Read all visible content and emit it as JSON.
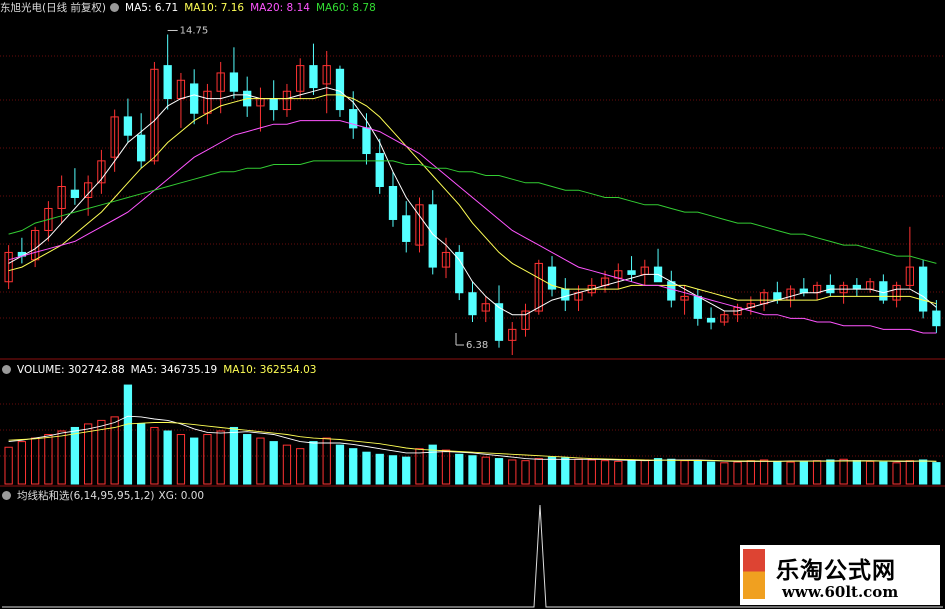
{
  "header": {
    "stock_title": "东旭光电(日线 前复权)",
    "ma5": "MA5: 6.71",
    "ma10": "MA10: 7.16",
    "ma20": "MA20: 8.14",
    "ma60": "MA60: 8.78"
  },
  "volume_header": {
    "title": "VOLUME: 302742.88",
    "ma5": "MA5: 346735.19",
    "ma10": "MA10: 362554.03"
  },
  "indicator_header": {
    "title": "均线粘和选(6,14,95,95,1,2)",
    "xg": "XG: 0.00"
  },
  "watermark": {
    "name": "乐淘公式网",
    "url": "www.60lt.com"
  },
  "colors": {
    "up": "#ff3333",
    "down": "#54ffff",
    "ma5": "#ffffff",
    "ma10": "#ffff55",
    "ma20": "#ff55ff",
    "ma60": "#33cc33",
    "grid": "#8b1010",
    "bg": "#000000"
  },
  "chart_data": {
    "type": "candlestick",
    "price": {
      "ylim": [
        6.0,
        15.2
      ],
      "max_label": "14.75",
      "min_label": "6.38",
      "max_point": {
        "x": 48,
        "value": 14.75
      },
      "min_point": {
        "x": 456,
        "value": 6.38
      },
      "ohlc": [
        [
          8.0,
          9.0,
          7.8,
          8.8
        ],
        [
          8.8,
          9.2,
          8.5,
          8.7
        ],
        [
          8.6,
          9.5,
          8.4,
          9.4
        ],
        [
          9.4,
          10.2,
          9.1,
          10.0
        ],
        [
          10.0,
          10.9,
          9.6,
          10.6
        ],
        [
          10.5,
          11.1,
          10.1,
          10.3
        ],
        [
          10.3,
          10.9,
          9.8,
          10.7
        ],
        [
          10.7,
          11.6,
          10.4,
          11.3
        ],
        [
          11.4,
          12.7,
          11.0,
          12.5
        ],
        [
          12.5,
          13.0,
          11.8,
          12.0
        ],
        [
          12.0,
          12.6,
          11.1,
          11.3
        ],
        [
          11.3,
          14.0,
          11.2,
          13.8
        ],
        [
          13.9,
          14.75,
          12.7,
          13.0
        ],
        [
          13.0,
          13.7,
          12.2,
          13.5
        ],
        [
          13.4,
          13.8,
          12.3,
          12.6
        ],
        [
          12.6,
          13.4,
          12.3,
          13.2
        ],
        [
          13.2,
          14.0,
          12.6,
          13.7
        ],
        [
          13.7,
          14.4,
          13.0,
          13.2
        ],
        [
          13.2,
          13.6,
          12.5,
          12.8
        ],
        [
          12.8,
          13.3,
          12.1,
          13.0
        ],
        [
          13.0,
          13.5,
          12.4,
          12.7
        ],
        [
          12.7,
          13.4,
          12.5,
          13.2
        ],
        [
          13.2,
          14.1,
          13.0,
          13.9
        ],
        [
          13.9,
          14.5,
          13.1,
          13.3
        ],
        [
          13.4,
          14.3,
          12.6,
          13.9
        ],
        [
          13.8,
          13.9,
          12.5,
          12.7
        ],
        [
          12.7,
          13.2,
          11.9,
          12.2
        ],
        [
          12.2,
          12.6,
          11.2,
          11.5
        ],
        [
          11.5,
          11.9,
          10.4,
          10.6
        ],
        [
          10.6,
          11.0,
          9.5,
          9.7
        ],
        [
          9.8,
          10.2,
          8.8,
          9.1
        ],
        [
          9.0,
          10.3,
          8.8,
          10.1
        ],
        [
          10.1,
          10.5,
          8.2,
          8.4
        ],
        [
          8.4,
          9.2,
          8.1,
          8.8
        ],
        [
          8.8,
          9.0,
          7.5,
          7.7
        ],
        [
          7.7,
          8.0,
          6.9,
          7.1
        ],
        [
          7.2,
          7.6,
          6.9,
          7.4
        ],
        [
          7.4,
          7.9,
          6.2,
          6.4
        ],
        [
          6.4,
          6.9,
          6.0,
          6.7
        ],
        [
          6.7,
          7.4,
          6.5,
          7.2
        ],
        [
          7.2,
          8.6,
          7.1,
          8.5
        ],
        [
          8.4,
          8.7,
          7.6,
          7.8
        ],
        [
          7.8,
          8.1,
          7.2,
          7.5
        ],
        [
          7.5,
          7.9,
          7.2,
          7.7
        ],
        [
          7.7,
          8.1,
          7.6,
          7.9
        ],
        [
          7.9,
          8.3,
          7.7,
          8.1
        ],
        [
          8.1,
          8.5,
          7.8,
          8.3
        ],
        [
          8.3,
          8.7,
          8.0,
          8.2
        ],
        [
          8.2,
          8.6,
          7.9,
          8.4
        ],
        [
          8.4,
          8.9,
          8.1,
          8.0
        ],
        [
          8.0,
          8.3,
          7.3,
          7.5
        ],
        [
          7.5,
          7.9,
          7.1,
          7.6
        ],
        [
          7.6,
          7.8,
          6.8,
          7.0
        ],
        [
          7.0,
          7.3,
          6.7,
          6.9
        ],
        [
          6.9,
          7.2,
          6.8,
          7.1
        ],
        [
          7.1,
          7.4,
          6.9,
          7.3
        ],
        [
          7.3,
          7.6,
          7.1,
          7.4
        ],
        [
          7.4,
          7.8,
          7.2,
          7.7
        ],
        [
          7.7,
          8.0,
          7.4,
          7.5
        ],
        [
          7.5,
          7.9,
          7.3,
          7.8
        ],
        [
          7.8,
          8.1,
          7.6,
          7.7
        ],
        [
          7.7,
          8.0,
          7.5,
          7.9
        ],
        [
          7.9,
          8.2,
          7.6,
          7.7
        ],
        [
          7.7,
          8.0,
          7.4,
          7.9
        ],
        [
          7.9,
          8.1,
          7.6,
          7.8
        ],
        [
          7.8,
          8.1,
          7.7,
          8.0
        ],
        [
          8.0,
          8.2,
          7.4,
          7.5
        ],
        [
          7.5,
          8.0,
          7.3,
          7.9
        ],
        [
          7.9,
          9.5,
          7.8,
          8.4
        ],
        [
          8.4,
          8.6,
          7.0,
          7.2
        ],
        [
          7.2,
          7.5,
          6.6,
          6.8
        ]
      ],
      "series": [
        {
          "key": "ma5",
          "values": [
            8.5,
            8.7,
            8.9,
            9.2,
            9.6,
            10.0,
            10.4,
            10.8,
            11.3,
            11.8,
            12.1,
            12.4,
            12.8,
            13.0,
            13.1,
            13.0,
            13.0,
            13.1,
            13.1,
            13.0,
            13.0,
            13.0,
            13.1,
            13.2,
            13.3,
            13.2,
            12.9,
            12.4,
            11.8,
            11.0,
            10.3,
            9.8,
            9.3,
            9.0,
            8.6,
            8.0,
            7.6,
            7.3,
            7.1,
            7.1,
            7.3,
            7.5,
            7.6,
            7.7,
            7.8,
            7.9,
            8.0,
            8.1,
            8.2,
            8.2,
            8.0,
            7.8,
            7.6,
            7.4,
            7.2,
            7.2,
            7.3,
            7.4,
            7.5,
            7.6,
            7.7,
            7.7,
            7.8,
            7.8,
            7.8,
            7.8,
            7.7,
            7.8,
            7.8,
            7.6,
            7.3
          ]
        },
        {
          "key": "ma10",
          "values": [
            8.3,
            8.4,
            8.6,
            8.8,
            9.0,
            9.3,
            9.6,
            9.9,
            10.3,
            10.7,
            11.1,
            11.4,
            11.8,
            12.1,
            12.4,
            12.6,
            12.8,
            12.9,
            13.0,
            13.0,
            13.0,
            13.0,
            13.0,
            13.0,
            13.1,
            13.1,
            13.0,
            12.8,
            12.5,
            12.1,
            11.7,
            11.3,
            10.9,
            10.5,
            10.1,
            9.6,
            9.2,
            8.8,
            8.5,
            8.3,
            8.1,
            7.9,
            7.8,
            7.8,
            7.8,
            7.8,
            7.8,
            7.9,
            7.9,
            7.9,
            7.9,
            7.9,
            7.8,
            7.7,
            7.6,
            7.5,
            7.5,
            7.5,
            7.5,
            7.5,
            7.5,
            7.5,
            7.6,
            7.6,
            7.6,
            7.6,
            7.6,
            7.6,
            7.6,
            7.5,
            7.4
          ]
        },
        {
          "key": "ma20",
          "values": [
            8.6,
            8.7,
            8.8,
            8.9,
            9.0,
            9.1,
            9.3,
            9.5,
            9.7,
            9.9,
            10.2,
            10.5,
            10.8,
            11.1,
            11.4,
            11.6,
            11.8,
            12.0,
            12.1,
            12.2,
            12.3,
            12.3,
            12.4,
            12.4,
            12.4,
            12.4,
            12.3,
            12.2,
            12.1,
            11.9,
            11.7,
            11.5,
            11.2,
            10.9,
            10.6,
            10.3,
            10.0,
            9.7,
            9.4,
            9.2,
            9.0,
            8.8,
            8.6,
            8.4,
            8.3,
            8.2,
            8.1,
            8.0,
            7.9,
            7.9,
            7.8,
            7.7,
            7.6,
            7.5,
            7.4,
            7.3,
            7.2,
            7.1,
            7.1,
            7.0,
            7.0,
            6.9,
            6.9,
            6.8,
            6.8,
            6.8,
            6.7,
            6.7,
            6.7,
            6.6,
            6.6
          ]
        },
        {
          "key": "ma60",
          "values": [
            9.3,
            9.4,
            9.6,
            9.7,
            9.8,
            9.9,
            10.0,
            10.1,
            10.2,
            10.3,
            10.4,
            10.5,
            10.6,
            10.7,
            10.8,
            10.9,
            11.0,
            11.0,
            11.1,
            11.1,
            11.2,
            11.2,
            11.2,
            11.3,
            11.3,
            11.3,
            11.3,
            11.3,
            11.3,
            11.3,
            11.2,
            11.2,
            11.1,
            11.1,
            11.0,
            11.0,
            10.9,
            10.9,
            10.8,
            10.7,
            10.7,
            10.6,
            10.5,
            10.5,
            10.4,
            10.3,
            10.3,
            10.2,
            10.1,
            10.1,
            10.0,
            9.9,
            9.9,
            9.8,
            9.7,
            9.6,
            9.6,
            9.5,
            9.4,
            9.3,
            9.3,
            9.2,
            9.1,
            9.0,
            9.0,
            8.9,
            8.8,
            8.7,
            8.7,
            8.6,
            8.5
          ]
        }
      ]
    },
    "volume": {
      "ylim": [
        0,
        1500000
      ],
      "values": [
        520000,
        600000,
        650000,
        700000,
        750000,
        800000,
        850000,
        900000,
        950000,
        1400000,
        850000,
        800000,
        750000,
        700000,
        650000,
        700000,
        750000,
        800000,
        700000,
        650000,
        600000,
        550000,
        500000,
        600000,
        650000,
        550000,
        500000,
        450000,
        420000,
        400000,
        380000,
        500000,
        550000,
        480000,
        420000,
        400000,
        380000,
        360000,
        340000,
        330000,
        360000,
        380000,
        370000,
        350000,
        340000,
        330000,
        320000,
        330000,
        340000,
        360000,
        350000,
        330000,
        320000,
        310000,
        300000,
        310000,
        330000,
        340000,
        320000,
        310000,
        320000,
        330000,
        340000,
        350000,
        330000,
        320000,
        310000,
        300000,
        330000,
        340000,
        302742.88
      ],
      "up": [
        true,
        true,
        true,
        true,
        true,
        false,
        true,
        true,
        true,
        false,
        false,
        true,
        false,
        true,
        false,
        true,
        true,
        false,
        false,
        true,
        false,
        true,
        true,
        false,
        true,
        false,
        false,
        false,
        false,
        false,
        false,
        true,
        false,
        true,
        false,
        false,
        true,
        false,
        true,
        true,
        true,
        false,
        false,
        true,
        true,
        true,
        true,
        false,
        true,
        false,
        false,
        true,
        false,
        false,
        true,
        true,
        true,
        true,
        false,
        true,
        false,
        true,
        false,
        true,
        false,
        true,
        false,
        true,
        true,
        false,
        false
      ],
      "ma5_values": [
        600000,
        620000,
        650000,
        680000,
        720000,
        750000,
        780000,
        820000,
        870000,
        960000,
        950000,
        920000,
        900000,
        850000,
        780000,
        730000,
        720000,
        730000,
        740000,
        720000,
        700000,
        650000,
        600000,
        580000,
        580000,
        580000,
        560000,
        530000,
        500000,
        470000,
        440000,
        440000,
        450000,
        460000,
        450000,
        440000,
        420000,
        400000,
        380000,
        360000,
        350000,
        350000,
        350000,
        350000,
        350000,
        345000,
        340000,
        335000,
        330000,
        335000,
        340000,
        340000,
        340000,
        335000,
        325000,
        320000,
        320000,
        320000,
        320000,
        325000,
        325000,
        325000,
        325000,
        330000,
        330000,
        330000,
        325000,
        320000,
        320000,
        325000,
        320000
      ],
      "ma10_values": [
        620000,
        630000,
        640000,
        660000,
        680000,
        710000,
        740000,
        770000,
        800000,
        850000,
        860000,
        870000,
        870000,
        860000,
        840000,
        820000,
        800000,
        780000,
        760000,
        740000,
        720000,
        700000,
        670000,
        650000,
        640000,
        630000,
        610000,
        590000,
        570000,
        540000,
        510000,
        490000,
        480000,
        470000,
        460000,
        450000,
        440000,
        430000,
        420000,
        410000,
        400000,
        390000,
        380000,
        370000,
        360000,
        355000,
        350000,
        345000,
        340000,
        338000,
        336000,
        334000,
        332000,
        330000,
        328000,
        326000,
        325000,
        324000,
        323000,
        322000,
        322000,
        322000,
        323000,
        324000,
        325000,
        326000,
        326000,
        325000,
        324000,
        324000,
        322000
      ]
    },
    "indicator": {
      "type": "line",
      "ylim": [
        0,
        1
      ],
      "values": [
        0,
        0,
        0,
        0,
        0,
        0,
        0,
        0,
        0,
        0,
        0,
        0,
        0,
        0,
        0,
        0,
        0,
        0,
        0,
        0,
        0,
        0,
        0,
        0,
        0,
        0,
        0,
        0,
        0,
        0,
        0,
        0,
        0,
        0,
        0,
        0,
        0,
        0,
        0,
        0,
        0,
        0,
        0,
        0,
        0,
        0,
        0,
        0,
        0,
        0,
        0,
        0,
        0,
        0,
        0,
        0,
        0,
        0,
        0,
        0,
        0,
        0,
        0,
        0,
        0,
        0,
        0,
        0,
        0,
        0,
        0
      ],
      "spike": {
        "x": 540,
        "value": 1
      }
    }
  }
}
